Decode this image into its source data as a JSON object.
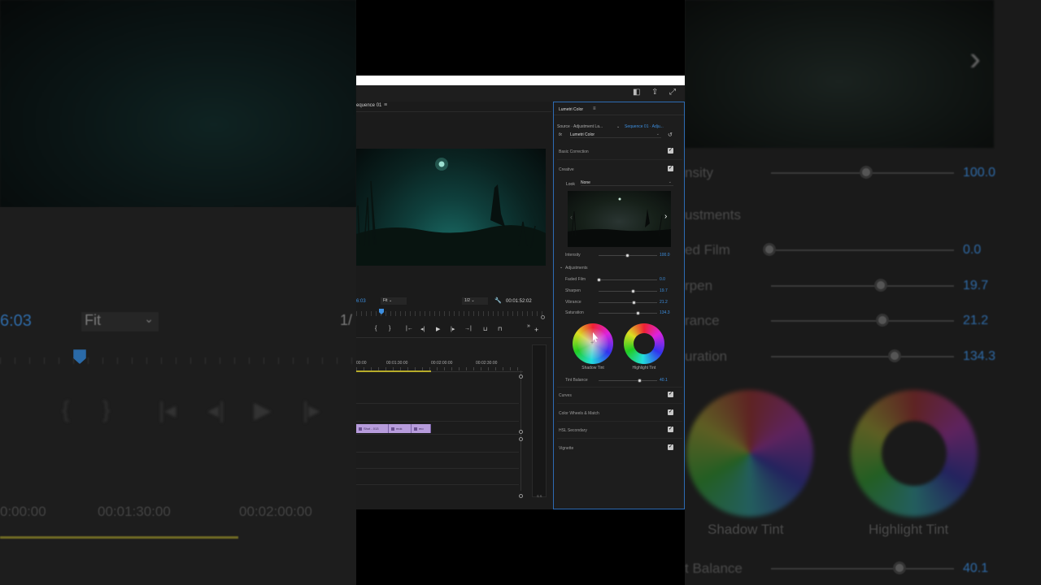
{
  "background": {
    "left_timecode": "6:03",
    "left_fit": "Fit",
    "left_ratio": "1/",
    "left_times": [
      "0:00:00",
      "00:01:30:00",
      "00:02:00:00"
    ],
    "right_labels": [
      "nsity",
      "ustments",
      "ed Film",
      "rpen",
      "rance",
      "uration",
      "Shadow Tint",
      "Highlight Tint",
      "t Balance"
    ],
    "right_values": [
      "100.0",
      "0.0",
      "19.7",
      "21.2",
      "134.3",
      "40.1"
    ]
  },
  "program": {
    "tab": "equence 01",
    "timecode_left": "6:03",
    "fit": "Fit",
    "ratio": "1/2",
    "timecode_right": "00:01:52:02",
    "transport": [
      "{",
      "}",
      "|←",
      "◂|",
      "▶",
      "|▸",
      "→|",
      "⊔",
      "⊓",
      "»",
      "+"
    ]
  },
  "timeline": {
    "times": [
      "00:00",
      "00:01:30:00",
      "00:02:00:00",
      "00:02:30:00"
    ],
    "clips": [
      {
        "label": "Shot - 013",
        "w": 40
      },
      {
        "label": "mok",
        "w": 28
      },
      {
        "label": "mo",
        "w": 22
      }
    ],
    "meter_label": "S S"
  },
  "lumetri": {
    "title": "Lumetri Color",
    "source": "Source · Adjustment La...",
    "sequence": "Sequence 01 · Adju...",
    "fx": "fx",
    "effect": "Lumetri Color",
    "sections_top": [
      "Basic Correction",
      "Creative"
    ],
    "look_label": "Look",
    "look_value": "None",
    "intensity_label": "Intensity",
    "intensity_value": "100.0",
    "adjustments_label": "Adjustments",
    "sliders": [
      {
        "label": "Faded Film",
        "value": "0.0",
        "pos": 0.0
      },
      {
        "label": "Sharpen",
        "value": "19.7",
        "pos": 0.59
      },
      {
        "label": "Vibrance",
        "value": "21.2",
        "pos": 0.6
      },
      {
        "label": "Saturation",
        "value": "134.3",
        "pos": 0.67
      }
    ],
    "shadow_tint": "Shadow Tint",
    "highlight_tint": "Highlight Tint",
    "tint_balance_label": "Tint Balance",
    "tint_balance_value": "40.1",
    "tint_balance_pos": 0.7,
    "sections_bottom": [
      "Curves",
      "Color Wheels & Match",
      "HSL Secondary",
      "Vignette"
    ]
  }
}
